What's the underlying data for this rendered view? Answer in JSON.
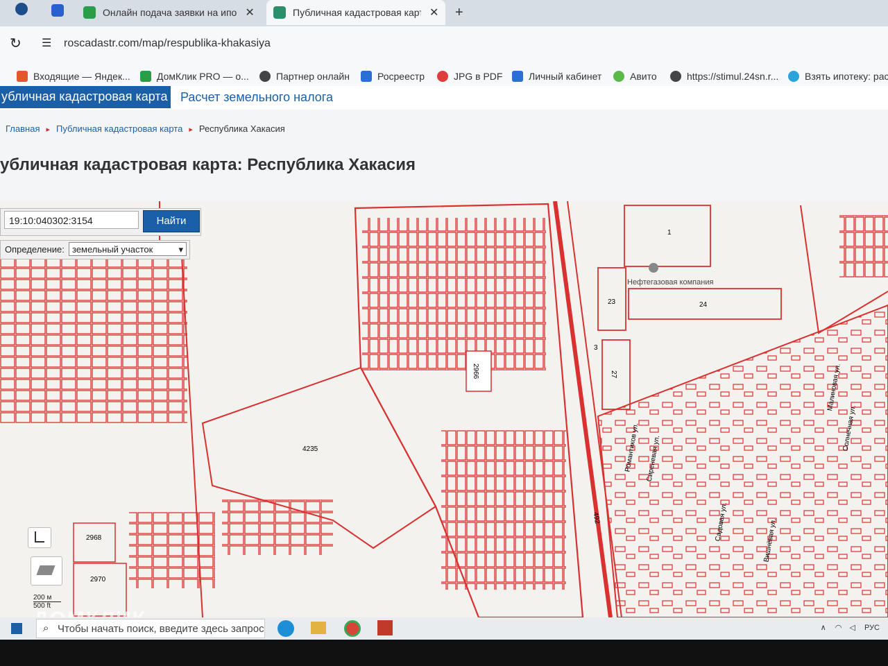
{
  "browser": {
    "tabs": [
      {
        "label": "Онлайн подача заявки на ипо",
        "close": "✕"
      },
      {
        "label": "Публичная кадастровая карта",
        "close": "✕"
      }
    ],
    "new_tab": "+",
    "url": "roscadastr.com/map/respublika-khakasiya",
    "bookmarks": [
      "Входящие — Яндек...",
      "ДомКлик PRO — о...",
      "Партнер онлайн",
      "Росреестр",
      "JPG в PDF",
      "Личный кабинет",
      "Авито",
      "https://stimul.24sn.r...",
      "Взять ипотеку: расс..."
    ]
  },
  "site": {
    "nav_active": "убличная кадастровая карта",
    "nav_link": "Расчет земельного налога",
    "breadcrumbs": [
      "Главная",
      "Публичная кадастровая карта",
      "Республика Хакасия"
    ],
    "title": "убличная кадастровая карта: Республика Хакасия"
  },
  "search": {
    "value": "19:10:040302:3154",
    "button": "Найти",
    "def_label": "Определение:",
    "def_value": "земельный участок"
  },
  "map": {
    "parcel_labels": [
      "2966",
      "4235",
      "2968",
      "2970",
      "23",
      "24",
      "27",
      "3",
      "1",
      "492"
    ],
    "poi": "Нефтегазовая компания",
    "streets": [
      "Сиреневая ул.",
      "Садовая ул.",
      "Малиновая ул.",
      "Вишнёвая ул.",
      "Романтиков ул.",
      "Солнечная ул."
    ],
    "scale": [
      "200 м",
      "500 ft"
    ],
    "parcel_color": "#d93030"
  },
  "taskbar": {
    "search_placeholder": "Чтобы начать поиск, введите здесь запрос",
    "lang": "РУС"
  },
  "watermark": "ДОМКЛИК"
}
